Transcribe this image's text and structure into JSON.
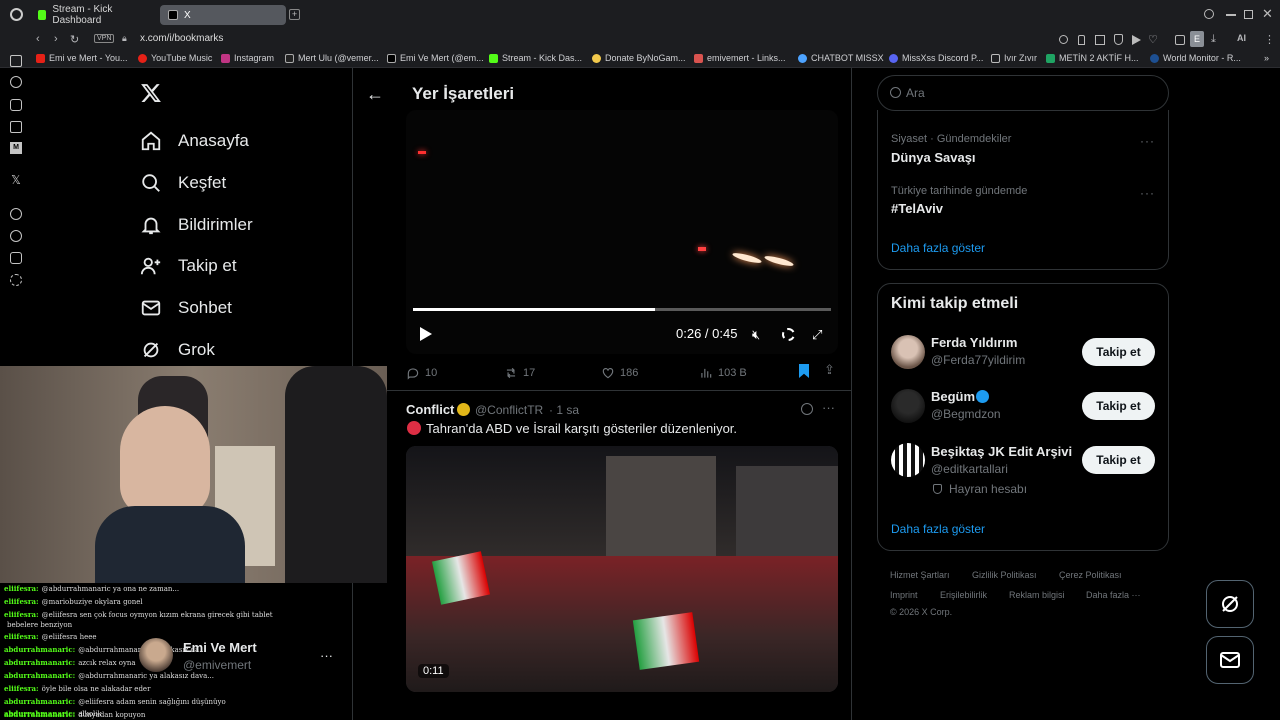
{
  "browser": {
    "tabs": [
      {
        "label": "Stream - Kick Dashboard"
      },
      {
        "label": "X"
      }
    ],
    "url": "x.com/i/bookmarks",
    "vpn": "VPN",
    "bookmarks": [
      "Emi ve Mert - You...",
      "YouTube Music",
      "Instagram",
      "Mert Ulu (@vemer...",
      "Emi Ve Mert (@em...",
      "Stream - Kick Das...",
      "Donate ByNoGam...",
      "emivemert - Links...",
      "CHATBOT MISSX",
      "MissXss Discord P...",
      "Ivır Zıvır",
      "METİN 2 AKTİF H...",
      "World Monitor - R..."
    ],
    "ai_label": "AI"
  },
  "nav": {
    "items": [
      {
        "label": "Anasayfa"
      },
      {
        "label": "Keşfet"
      },
      {
        "label": "Bildirimler"
      },
      {
        "label": "Takip et"
      },
      {
        "label": "Sohbet"
      },
      {
        "label": "Grok"
      }
    ]
  },
  "main": {
    "title": "Yer İşaretleri",
    "video1": {
      "time": "0:26 / 0:45",
      "progress": 0.58
    },
    "stats": {
      "replies": "10",
      "reposts": "17",
      "likes": "186",
      "views": "103 B"
    },
    "tweet2": {
      "author": "Conflict",
      "handle": "@ConflictTR",
      "time": "· 1 sa",
      "text": "Tahran'da ABD ve İsrail karşıtı gösteriler düzenleniyor.",
      "video_duration": "0:11"
    }
  },
  "right": {
    "search_placeholder": "Ara",
    "trends": [
      {
        "context": "Siyaset · Gündemdekiler",
        "name": "Dünya Savaşı"
      },
      {
        "context": "Türkiye tarihinde gündemde",
        "name": "#TelAviv"
      }
    ],
    "trends_more": "Daha fazla göster",
    "who_to_follow_title": "Kimi takip etmeli",
    "suggestions": [
      {
        "name": "Ferda Yıldırım",
        "handle": "@Ferda77yildirim",
        "button": "Takip et"
      },
      {
        "name": "Begüm",
        "handle": "@Begmdzon",
        "button": "Takip et"
      },
      {
        "name": "Beşiktaş JK Edit Arşivi",
        "handle": "@editkartallari",
        "note": "Hayran hesabı",
        "button": "Takip et"
      }
    ],
    "follow_more": "Daha fazla göster",
    "footer": [
      "Hizmet Şartları",
      "Gizlilik Politikası",
      "Çerez Politikası",
      "Imprint",
      "Erişilebilirlik",
      "Reklam bilgisi",
      "Daha fazla ···",
      "© 2026 X Corp."
    ]
  },
  "account": {
    "name": "Emi Ve Mert",
    "handle": "@emivemert"
  },
  "chat": [
    {
      "user": "eliifesra:",
      "msg": "@abdurrahmanaric ya ona ne zaman..."
    },
    {
      "user": "eliifesra:",
      "msg": "@mariobuziye okylara gonel"
    },
    {
      "user": "eliifesra:",
      "msg": "@eliifesra sen çok focus oymyon kızım ekrana girecek gibi tablet"
    },
    {
      "user": "",
      "msg": "bebelere benziyon"
    },
    {
      "user": "eliifesra:",
      "msg": "@eliifesra heee"
    },
    {
      "user": "abdurrahmanaric:",
      "msg": "@abdurrahmanaric ya alakasız da..."
    },
    {
      "user": "abdurrahmanaric:",
      "msg": "azcık relax oyna"
    },
    {
      "user": "abdurrahmanaric:",
      "msg": "@abdurrahmanaric ya alakasız dava..."
    },
    {
      "user": "eliifesra:",
      "msg": "öyle bile olsa ne alakadar eder"
    },
    {
      "user": "abdurrahmanaric:",
      "msg": "@eliifesra adam senin sağlığını düşünüyo"
    },
    {
      "user": "abdurrahmanaric:",
      "msg": "dünyadan kopuyon"
    },
    {
      "user": "abdurrahmanaric:",
      "msg": "alkolik"
    }
  ]
}
